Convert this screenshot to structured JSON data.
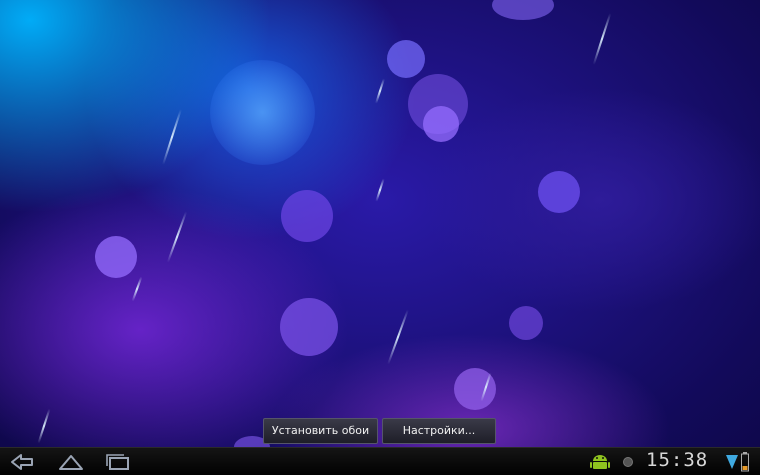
{
  "wallpaper_menu": {
    "set_wallpaper_label": "Установить обои",
    "settings_label": "Настройки..."
  },
  "status_bar": {
    "time": "15:38"
  },
  "nav_icons": [
    "back-icon",
    "home-icon",
    "recent-apps-icon"
  ],
  "status_icons": [
    "android-notification-icon",
    "circle-status-icon",
    "wifi-signal-icon",
    "battery-icon"
  ],
  "colors": {
    "wallpaper_accent": "#2a1aa8",
    "menu_button_bg": "#2a2a36",
    "navbar_bg": "#000000",
    "clock_text": "#d8d8d8"
  }
}
